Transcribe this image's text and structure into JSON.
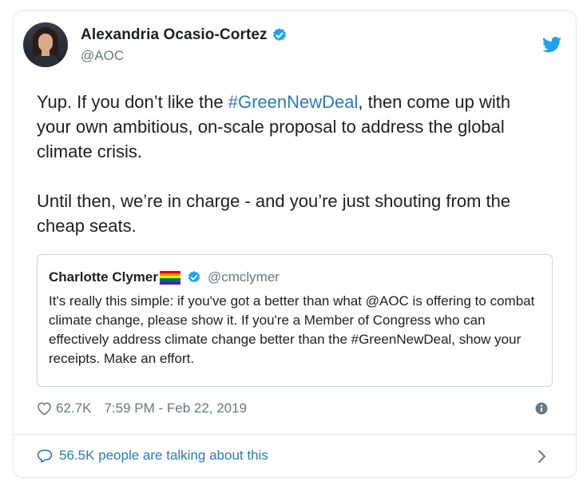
{
  "author": {
    "name": "Alexandria Ocasio-Cortez",
    "handle": "@AOC"
  },
  "tweet": {
    "line1_before": "Yup. If you don’t like the ",
    "line1_hashtag": "#GreenNewDeal",
    "line1_after": ", then come up with your own ambitious, on-scale proposal to address the global climate crisis.",
    "paragraph2": "Until then, we’re in charge - and you’re just shouting from the cheap seats."
  },
  "quote": {
    "name": "Charlotte Clymer",
    "handle": "@cmclymer",
    "text": "It's really this simple: if you've got a better than what @AOC is offering to combat climate change, please show it. If you're a Member of Congress who can effectively address climate change better than the #GreenNewDeal, show your receipts. Make an effort."
  },
  "meta": {
    "likes": "62.7K",
    "timestamp": "7:59 PM - Feb 22, 2019"
  },
  "footer": {
    "talking": "56.5K people are talking about this"
  },
  "colors": {
    "link": "#2b7bb9",
    "verified": "#1da1f2",
    "muted": "#697882",
    "border": "#e1e8ed"
  },
  "icons": [
    "verified-badge-icon",
    "twitter-bird-icon",
    "rainbow-flag-icon",
    "heart-icon",
    "info-icon",
    "speech-bubble-icon",
    "chevron-right-icon"
  ]
}
